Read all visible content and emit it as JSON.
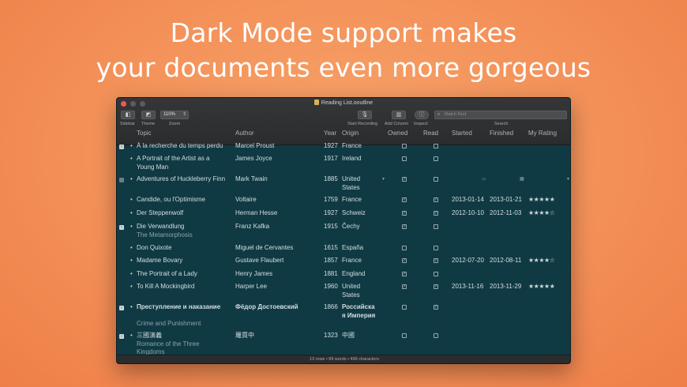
{
  "headline": {
    "line1": "Dark Mode support makes",
    "line2": "your documents even more gorgeous"
  },
  "window": {
    "title": "Reading List.ooutline"
  },
  "toolbar": {
    "sidebar_label": "Sidebar",
    "theme_label": "Theme",
    "zoom_value": "110%",
    "zoom_label": "Zoom",
    "start_recording_label": "Start Recording",
    "add_column_label": "Add Column",
    "inspect_label": "Inspect",
    "search_placeholder": "Match Find",
    "search_label": "Search"
  },
  "columns": {
    "topic": "Topic",
    "author": "Author",
    "year": "Year",
    "origin": "Origin",
    "owned": "Owned",
    "read": "Read",
    "started": "Started",
    "finished": "Finished",
    "rating": "My Rating"
  },
  "rows": [
    {
      "topic": "À la recherche du temps perdu",
      "author": "Marcel Proust",
      "year": "1927",
      "origin": "France",
      "owned": false,
      "read": false,
      "started": "",
      "finished": "",
      "rating": ""
    },
    {
      "topic": "A Portrait of the Artist as a",
      "topic2": "Young Man",
      "author": "James Joyce",
      "year": "1917",
      "origin": "Ireland",
      "owned": false,
      "read": false,
      "started": "",
      "finished": "",
      "rating": ""
    },
    {
      "topic": "Adventures of Huckleberry Finn",
      "author": "Mark Twain",
      "year": "1885",
      "origin": "United",
      "origin2": "States",
      "owned": true,
      "read": false,
      "started": "",
      "finished": "",
      "rating": ""
    },
    {
      "topic": "Candide, ou l'Optimisme",
      "author": "Voltaire",
      "year": "1759",
      "origin": "France",
      "owned": true,
      "read": true,
      "started": "2013-01-14",
      "finished": "2013-01-21",
      "rating": "★★★★★"
    },
    {
      "topic": "Der Steppenwolf",
      "author": "Herman Hesse",
      "year": "1927",
      "origin": "Schweiz",
      "owned": true,
      "read": true,
      "started": "2012-10-10",
      "finished": "2012-11-03",
      "rating": "★★★★☆"
    },
    {
      "topic": "Die Verwandlung",
      "note": "The Metamorphosis",
      "author": "Franz Kafka",
      "year": "1915",
      "origin": "Čechy",
      "owned": true,
      "read": false,
      "started": "",
      "finished": "",
      "rating": ""
    },
    {
      "topic": "Don Quixote",
      "author": "Miguel de Cervantes",
      "year": "1615",
      "origin": "España",
      "owned": false,
      "read": false,
      "started": "",
      "finished": "",
      "rating": ""
    },
    {
      "topic": "Madame Bovary",
      "author": "Gustave Flaubert",
      "year": "1857",
      "origin": "France",
      "owned": true,
      "read": true,
      "started": "2012-07-20",
      "finished": "2012-08-11",
      "rating": "★★★★☆"
    },
    {
      "topic": "The Portrait of a Lady",
      "author": "Henry James",
      "year": "1881",
      "origin": "England",
      "owned": true,
      "read": false,
      "started": "",
      "finished": "",
      "rating": ""
    },
    {
      "topic": "To Kill A Mockingbird",
      "author": "Harper Lee",
      "year": "1960",
      "origin": "United",
      "origin2": "States",
      "owned": true,
      "read": true,
      "started": "2013-11-16",
      "finished": "2013-11-29",
      "rating": "★★★★★"
    },
    {
      "topic": "Преступление и наказание",
      "note": "Crime and Punishment",
      "author": "Фёдор Достоевский",
      "year": "1866",
      "origin": "Российска",
      "origin2": "я Империя",
      "owned": false,
      "read": true,
      "started": "",
      "finished": "",
      "rating": ""
    },
    {
      "topic": "三國演義",
      "note": "Romance of the Three",
      "note2": "Kingdoms",
      "author": "羅貫中",
      "year": "1323",
      "origin": "中國",
      "owned": false,
      "read": false,
      "started": "",
      "finished": "",
      "rating": ""
    }
  ],
  "status": "13 rows • 89 words • 499 characters"
}
